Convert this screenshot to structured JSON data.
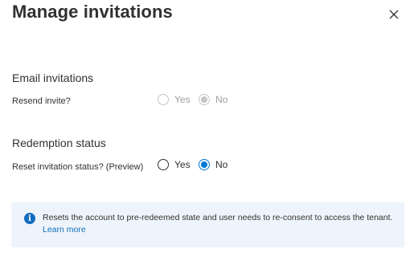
{
  "panel": {
    "title": "Manage invitations",
    "close_icon": "close-icon"
  },
  "email_invitations": {
    "heading": "Email invitations",
    "field_label": "Resend invite?",
    "disabled": true,
    "options": [
      {
        "label": "Yes",
        "selected": false
      },
      {
        "label": "No",
        "selected": true
      }
    ]
  },
  "redemption_status": {
    "heading": "Redemption status",
    "field_label": "Reset invitation status? (Preview)",
    "disabled": false,
    "options": [
      {
        "label": "Yes",
        "selected": false
      },
      {
        "label": "No",
        "selected": true
      }
    ]
  },
  "info_bar": {
    "icon": "info-icon",
    "message": "Resets the account to pre-redeemed state and user needs to re-consent to access the tenant.",
    "link_label": "Learn more"
  },
  "colors": {
    "accent": "#0078d4",
    "info_background": "#eef4fb",
    "disabled": "#c8c6c4"
  }
}
